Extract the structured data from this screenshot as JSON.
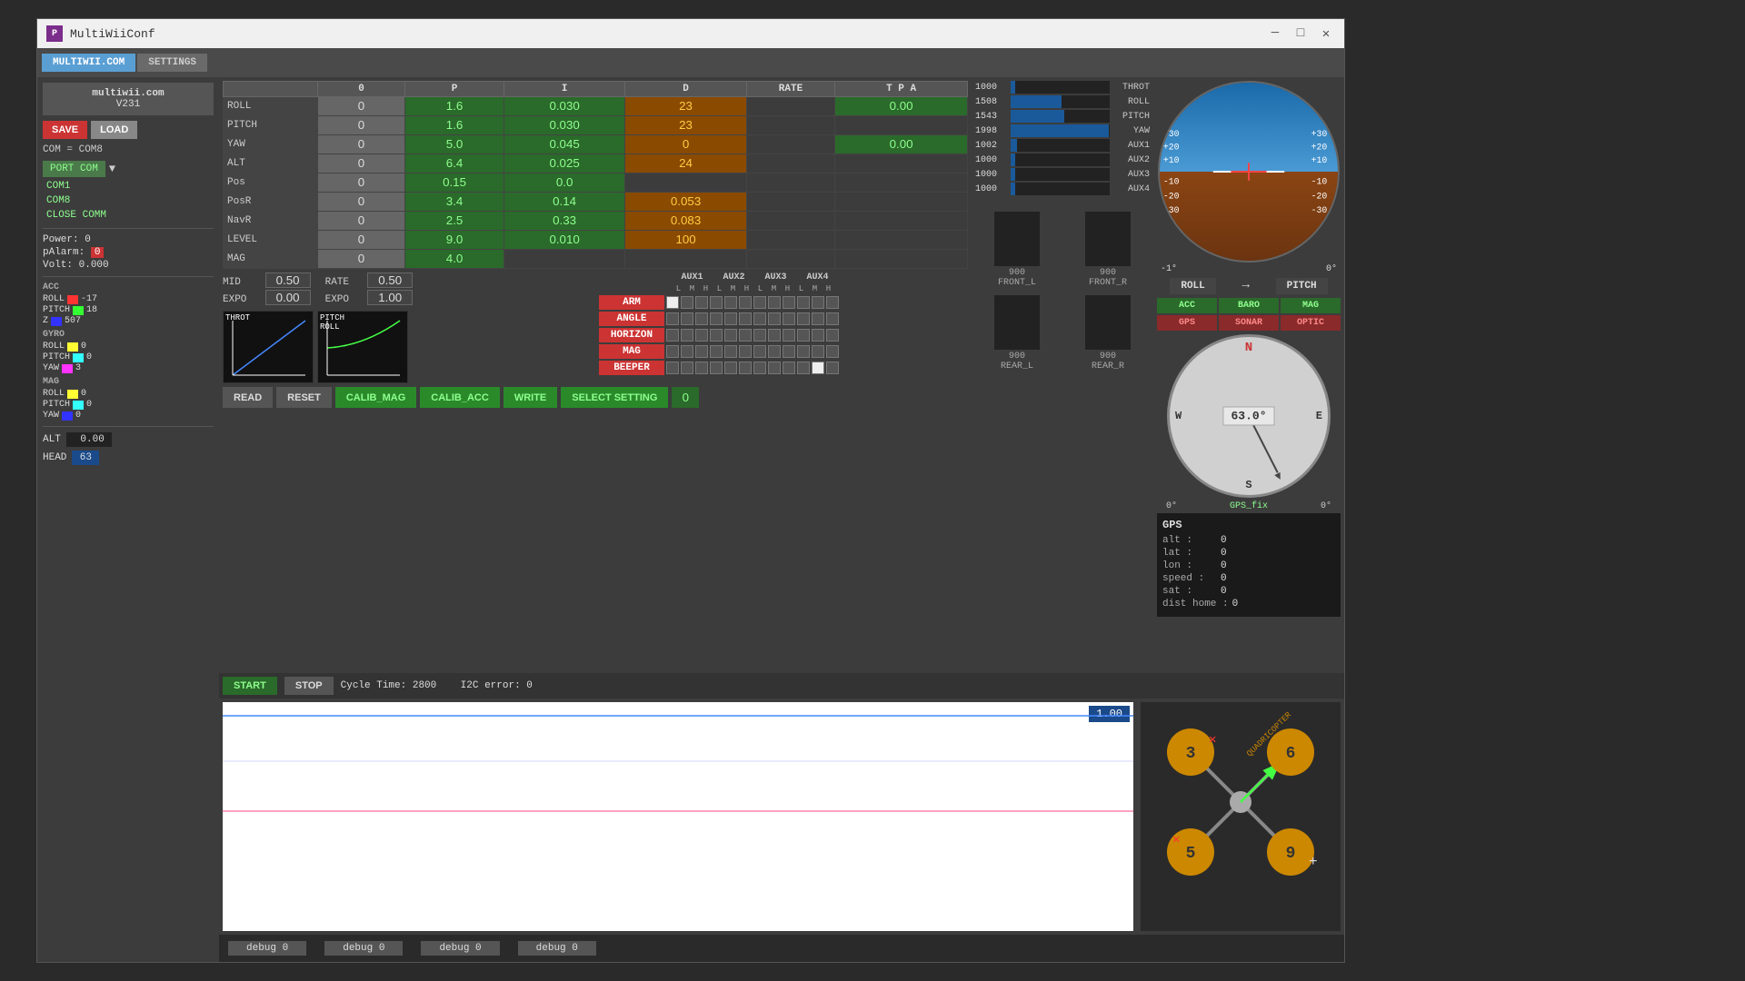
{
  "window": {
    "title": "MultiWiiConf",
    "icon_label": "P"
  },
  "menubar": {
    "items": [
      {
        "label": "MULTIWII.COM",
        "active": true
      },
      {
        "label": "SETTINGS",
        "active": false
      }
    ]
  },
  "left_panel": {
    "site": "multiwii.com",
    "version": "V231",
    "save_label": "SAVE",
    "load_label": "LOAD",
    "com_label": "COM = COM8",
    "port_com": "PORT COM",
    "com_ports": [
      "COM1",
      "COM8"
    ],
    "close_comm": "CLOSE COMM",
    "power_label": "Power:",
    "power_val": "0",
    "palarm_label": "pAlarm:",
    "palarm_val": "0",
    "volt_label": "Volt:",
    "volt_val": "0.000",
    "acc_label": "ACC",
    "acc_roll_label": "ROLL",
    "acc_roll_val": "-17",
    "acc_pitch_label": "PITCH",
    "acc_pitch_val": "18",
    "acc_z_label": "Z",
    "acc_z_val": "507",
    "gyro_label": "GYRO",
    "gyro_roll_label": "ROLL",
    "gyro_roll_val": "0",
    "gyro_pitch_label": "PITCH",
    "gyro_pitch_val": "0",
    "gyro_yaw_label": "YAW",
    "gyro_yaw_val": "3",
    "mag_label": "MAG",
    "mag_roll_label": "ROLL",
    "mag_roll_val": "0",
    "mag_pitch_label": "PITCH",
    "mag_pitch_val": "0",
    "mag_yaw_label": "YAW",
    "mag_yaw_val": "0",
    "alt_label": "ALT",
    "alt_val": "0.00",
    "head_label": "HEAD",
    "head_val": "63"
  },
  "pid_table": {
    "headers": [
      "",
      "0",
      "P",
      "I",
      "D",
      "RATE",
      "T P A"
    ],
    "rows": [
      {
        "label": "ROLL",
        "col0": "",
        "p": "1.6",
        "i": "0.030",
        "d": "23",
        "rate": "",
        "tpa": "0.00"
      },
      {
        "label": "PITCH",
        "col0": "",
        "p": "1.6",
        "i": "0.030",
        "d": "23",
        "rate": "",
        "tpa": ""
      },
      {
        "label": "YAW",
        "col0": "",
        "p": "5.0",
        "i": "0.045",
        "d": "0",
        "rate": "",
        "tpa": "0.00"
      },
      {
        "label": "ALT",
        "col0": "",
        "p": "6.4",
        "i": "0.025",
        "d": "24",
        "rate": "",
        "tpa": ""
      },
      {
        "label": "Pos",
        "col0": "",
        "p": "0.15",
        "i": "0.0",
        "d": "",
        "rate": "",
        "tpa": ""
      },
      {
        "label": "PosR",
        "col0": "",
        "p": "3.4",
        "i": "0.14",
        "d": "0.053",
        "rate": "",
        "tpa": ""
      },
      {
        "label": "NavR",
        "col0": "",
        "p": "2.5",
        "i": "0.33",
        "d": "0.083",
        "rate": "",
        "tpa": ""
      },
      {
        "label": "LEVEL",
        "col0": "",
        "p": "9.0",
        "i": "0.010",
        "d": "100",
        "rate": "",
        "tpa": ""
      },
      {
        "label": "MAG",
        "col0": "",
        "p": "4.0",
        "i": "",
        "d": "",
        "rate": "",
        "tpa": ""
      }
    ],
    "mid_label": "MID",
    "mid_val": "0.50",
    "expo_label": "EXPO",
    "expo_val": "0.00",
    "rate_label": "RATE",
    "rate_val": "0.50",
    "expo2_label": "EXPO",
    "expo2_val": "1.00"
  },
  "flight_modes": {
    "modes": [
      "ARM",
      "ANGLE",
      "HORIZON",
      "MAG",
      "BEEPER"
    ],
    "aux_headers": [
      "AUX1",
      "AUX2",
      "AUX3",
      "AUX4"
    ],
    "sub_headers": [
      "LOW",
      "MID",
      "HIGH",
      "L",
      "M",
      "H",
      "L",
      "M",
      "H",
      "L",
      "M",
      "H"
    ]
  },
  "channels": {
    "rows": [
      {
        "val": "1000",
        "bar_pct": 5,
        "name": "THROT"
      },
      {
        "val": "1508",
        "bar_pct": 51,
        "name": "ROLL"
      },
      {
        "val": "1543",
        "bar_pct": 54,
        "name": "PITCH"
      },
      {
        "val": "1998",
        "bar_pct": 99,
        "name": "YAW"
      },
      {
        "val": "1002",
        "bar_pct": 6,
        "name": "AUX1"
      },
      {
        "val": "1000",
        "bar_pct": 5,
        "name": "AUX2"
      },
      {
        "val": "1000",
        "bar_pct": 5,
        "name": "AUX3"
      },
      {
        "val": "1000",
        "bar_pct": 5,
        "name": "AUX4"
      }
    ]
  },
  "motors": {
    "cells": [
      {
        "label": "FRONT_L",
        "val": "900",
        "bar_pct": 0
      },
      {
        "label": "FRONT_R",
        "val": "900",
        "bar_pct": 0
      },
      {
        "label": "REAR_L",
        "val": "900",
        "bar_pct": 0
      },
      {
        "label": "REAR_R",
        "val": "900",
        "bar_pct": 0
      }
    ]
  },
  "attitude": {
    "roll_deg": "-1°",
    "pitch_deg": "0°",
    "roll_label": "ROLL",
    "pitch_label": "PITCH"
  },
  "sensors": {
    "acc": "ACC",
    "baro": "BARO",
    "mag": "MAG",
    "gps": "GPS",
    "sonar": "SONAR",
    "optic": "OPTIC"
  },
  "compass": {
    "value": "63.0°",
    "start_deg": "0°",
    "end_deg": "0°",
    "n": "N",
    "s": "S",
    "e": "E",
    "w": "W",
    "gps_fix": "GPS_fix"
  },
  "gps_data": {
    "title": "GPS",
    "alt_label": "alt :",
    "alt_val": "0",
    "lat_label": "lat :",
    "lat_val": "0",
    "lon_label": "lon :",
    "lon_val": "0",
    "speed_label": "speed :",
    "speed_val": "0",
    "sat_label": "sat :",
    "sat_val": "0",
    "dist_label": "dist home :",
    "dist_val": "0"
  },
  "start_stop": {
    "start_label": "START",
    "stop_label": "STOP",
    "cycle_label": "Cycle Time:",
    "cycle_val": "2800",
    "i2c_label": "I2C error:",
    "i2c_val": "0"
  },
  "graph": {
    "value": "1.00",
    "debug_tabs": [
      "debug 0",
      "debug 0",
      "debug 0",
      "debug 0"
    ]
  },
  "bottom_buttons": {
    "read": "READ",
    "reset": "RESET",
    "calib_mag": "CALIB_MAG",
    "calib_acc": "CALIB_ACC",
    "write": "WRITE",
    "select_setting": "SELECT SETTING",
    "select_val": "0"
  }
}
